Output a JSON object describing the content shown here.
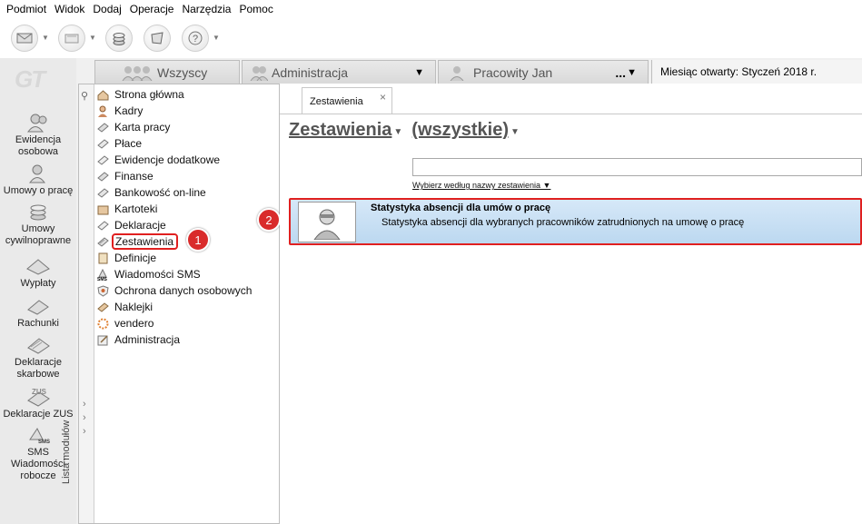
{
  "menu": [
    "Podmiot",
    "Widok",
    "Dodaj",
    "Operacje",
    "Narzędzia",
    "Pomoc"
  ],
  "toolbar": {
    "buttons": [
      "envelope-icon",
      "mail-icon",
      "coins-icon",
      "puzzle-icon",
      "help-icon"
    ]
  },
  "left_nav": {
    "logo": "GT",
    "items": [
      {
        "label": "Ewidencja osobowa",
        "icon": "people-icon"
      },
      {
        "label": "Umowy o pracę",
        "icon": "contract-icon"
      },
      {
        "label": "Umowy cywilnoprawne",
        "icon": "coins-icon"
      },
      {
        "label": "Wypłaty",
        "icon": "payout-icon"
      },
      {
        "label": "Rachunki",
        "icon": "bill-icon"
      },
      {
        "label": "Deklaracje skarbowe",
        "icon": "tax-icon"
      },
      {
        "label": "Deklaracje ZUS",
        "icon": "zus-icon"
      },
      {
        "label": "SMS Wiadomości robocze",
        "icon": "sms-icon"
      }
    ]
  },
  "tabs": {
    "all": "Wszyscy",
    "admin": "Administracja",
    "user": "Pracowity Jan",
    "user_more": "...",
    "month_label": "Miesiąc otwarty: Styczeń 2018 r."
  },
  "modules": {
    "sidebar_label": "Lista modułów",
    "items": [
      "Strona główna",
      "Kadry",
      "Karta pracy",
      "Płace",
      "Ewidencje dodatkowe",
      "Finanse",
      "Bankowość on-line",
      "Kartoteki",
      "Deklaracje",
      "Zestawienia",
      "Definicje",
      "Wiadomości SMS",
      "Ochrona danych osobowych",
      "Naklejki",
      "vendero",
      "Administracja"
    ],
    "selected": "Zestawienia"
  },
  "badges": {
    "one": "1",
    "two": "2"
  },
  "main": {
    "doc_tab": "Zestawienia",
    "doc_tab_close": "×",
    "heading_left": "Zestawienia",
    "heading_right": "(wszystkie)",
    "search_value": "",
    "sort_label": "Wybierz według nazwy zestawienia",
    "result": {
      "title": "Statystyka absencji dla umów o pracę",
      "description": "Statystyka absencji dla wybranych pracowników zatrudnionych na umowę o pracę"
    }
  },
  "colors": {
    "highlight": "#e02020",
    "selected_row": "#c7def4",
    "badge": "#d92b2b"
  }
}
